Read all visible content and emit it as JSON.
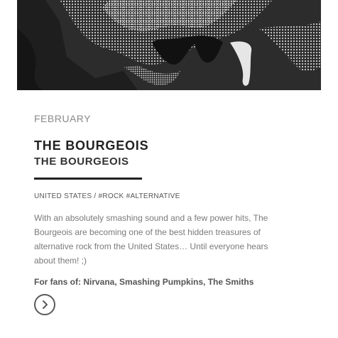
{
  "event": {
    "month": "FEBRUARY",
    "title": "THE BOURGEOIS",
    "subtitle": "THE BOURGEOIS",
    "tags": "UNITED STATES / #ROCK #ALTERNATIVE",
    "description": "With an absolutely smashing sound and a few power hits, The Bourgeois are becoming one of the best hidden treasures of alternative rock from the United States… Until everyone hears about them! ;)",
    "fans": "For fans of: Nirvana, Smashing Pumpkins, The Smiths"
  },
  "icons": {
    "more": "chevron-right-circle-icon"
  },
  "colors": {
    "heading": "#222222",
    "muted": "#8a8a8a",
    "body": "#7a7a7a",
    "hero_bg": "#2a2a2a"
  }
}
